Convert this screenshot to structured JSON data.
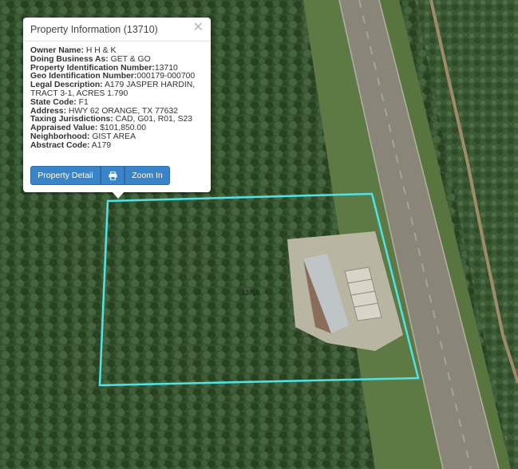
{
  "map": {
    "parcel_outline_color": "#4fe3e6",
    "parcel_label": "13710"
  },
  "popup": {
    "title": "Property Information (13710)",
    "close_icon": "close-icon",
    "fields": [
      {
        "label": "Owner Name:",
        "value": " H H & K"
      },
      {
        "label": "Doing Business As:",
        "value": " GET & GO"
      },
      {
        "label": "Property Identification Number:",
        "value": "13710"
      },
      {
        "label": "Geo Identification Number:",
        "value": "000179-000700"
      },
      {
        "label": "Legal Description:",
        "value": " A179 JASPER HARDIN, TRACT 3-1, ACRES 1.790"
      },
      {
        "label": "State Code:",
        "value": " F1"
      },
      {
        "label": "Address:",
        "value": " HWY 62 ORANGE, TX 77632"
      },
      {
        "label": "Taxing Jurisdictions:",
        "value": " CAD, G01, R01, S23"
      },
      {
        "label": "Appraised Value:",
        "value": " $101,850.00"
      },
      {
        "label": "Neighborhood:",
        "value": " GIST AREA"
      },
      {
        "label": "Abstract Code:",
        "value": " A179"
      }
    ],
    "buttons": {
      "property_detail": "Property Detail",
      "print_icon": "print-icon",
      "zoom_in": "Zoom In"
    }
  },
  "colors": {
    "button": "#3a84c9",
    "forest": "#2f4a2a",
    "road": "#8a8579"
  }
}
